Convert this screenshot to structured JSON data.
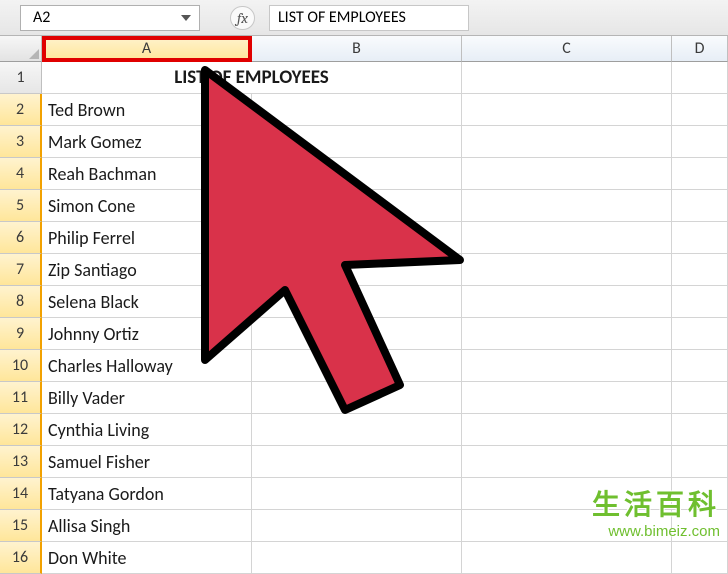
{
  "formula_bar": {
    "name_box": "A2",
    "fx_label": "fx",
    "formula_value": "LIST OF EMPLOYEES"
  },
  "columns": [
    "A",
    "B",
    "C",
    "D"
  ],
  "selected_column": "A",
  "rows": [
    1,
    2,
    3,
    4,
    5,
    6,
    7,
    8,
    9,
    10,
    11,
    12,
    13,
    14,
    15,
    16
  ],
  "title_cell": "LIST OF EMPLOYEES",
  "employees": [
    "Ted Brown",
    "Mark Gomez",
    "Reah Bachman",
    "Simon Cone",
    "Philip Ferrel",
    "Zip Santiago",
    "Selena Black",
    "Johnny Ortiz",
    "Charles Halloway",
    "Billy Vader",
    "Cynthia Living",
    "Samuel Fisher",
    "Tatyana Gordon",
    "Allisa Singh",
    "Don White"
  ],
  "watermark": {
    "cn": "生活百科",
    "url": "www.bimeiz.com"
  }
}
